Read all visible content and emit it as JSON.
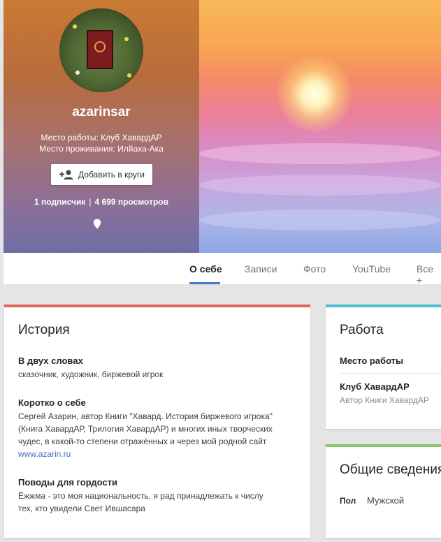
{
  "profile": {
    "username": "azarinsar",
    "work_line": "Место работы: Клуб ХавардАР",
    "home_line": "Место проживания: Илйаха-Ака",
    "add_button_label": "Добавить в круги",
    "followers": "1 подписчик",
    "separator": "|",
    "views": "4 699 просмотров"
  },
  "tabs": [
    {
      "label": "О себе",
      "active": true
    },
    {
      "label": "Записи"
    },
    {
      "label": "Фото"
    },
    {
      "label": "YouTube"
    },
    {
      "label": "Все +"
    }
  ],
  "history_card": {
    "title": "История",
    "accent": "#db6559",
    "sections": [
      {
        "label": "В двух словах",
        "lines": [
          "сказочник, художник, биржевой игрок"
        ]
      },
      {
        "label": "Коротко о себе",
        "lines": [
          "Сергей Азарин, автор Книги \"Хавард. История биржевого игрока\"",
          "(Книга ХавардАР, Трилогия ХавардАР) и многих иных творческих",
          "чудес, в какой-то степени отражённых и через мой родной сайт"
        ],
        "link": "www.azarin.ru"
      },
      {
        "label": "Поводы для гордости",
        "lines": [
          "Ёжжма - это моя национальность, я рад принадлежать к числу",
          "тех, кто увидели Свет Ившасара"
        ]
      }
    ]
  },
  "work_card": {
    "title": "Работа",
    "accent": "#4ebcd1",
    "label": "Место работы",
    "employer": "Клуб ХавардАР",
    "role": "Автор Книги ХавардАР"
  },
  "general_card": {
    "title": "Общие сведения",
    "accent": "#8bc36f",
    "gender_label": "Пол",
    "gender_value": "Мужской"
  }
}
